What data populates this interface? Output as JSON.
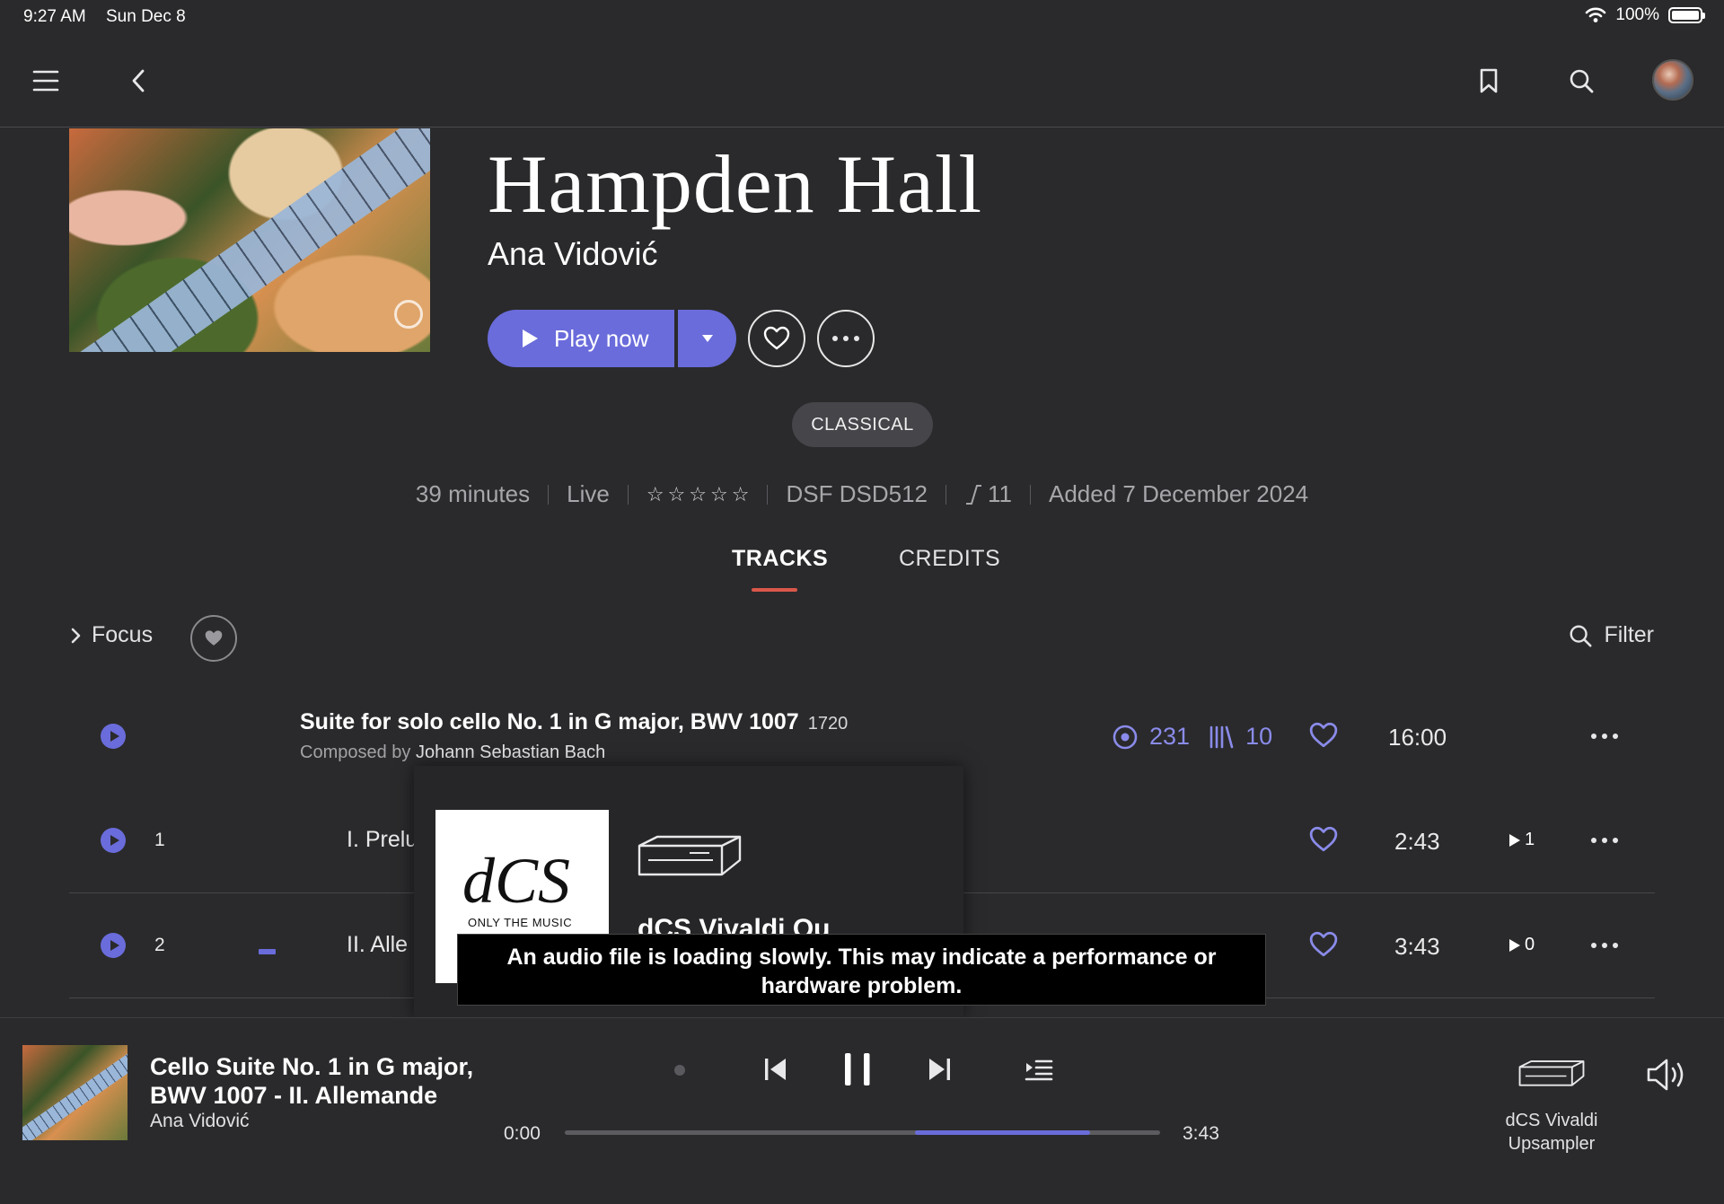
{
  "status_bar": {
    "time": "9:27 AM",
    "date": "Sun Dec 8",
    "battery": "100%",
    "icons": [
      "wifi-icon",
      "battery-icon"
    ]
  },
  "nav": {
    "icons": [
      "menu-icon",
      "back-icon",
      "bookmark-icon",
      "search-icon",
      "avatar"
    ]
  },
  "album": {
    "title": "Hampden Hall",
    "artist": "Ana Vidović",
    "play_label": "Play now",
    "genre": "CLASSICAL",
    "meta": {
      "duration": "39 minutes",
      "type": "Live",
      "rating": 0,
      "format": "DSF DSD512",
      "count": "11",
      "added": "Added 7 December 2024"
    }
  },
  "tabs": [
    {
      "label": "TRACKS",
      "active": true
    },
    {
      "label": "CREDITS",
      "active": false
    }
  ],
  "toolbar": {
    "focus_label": "Focus",
    "filter_label": "Filter"
  },
  "work": {
    "title": "Suite for solo cello No. 1 in G major, BWV 1007",
    "year": "1720",
    "composed_prefix": "Composed by",
    "composer": "Johann Sebastian Bach",
    "listeners": "231",
    "versions": "10",
    "duration": "16:00"
  },
  "tracks": [
    {
      "number": "1",
      "title": "I. Prelu",
      "duration": "2:43",
      "plays": "1"
    },
    {
      "number": "2",
      "title": "II. Alle",
      "duration": "3:43",
      "plays": "0"
    }
  ],
  "popup": {
    "logo_word": "dCS",
    "logo_tag": "ONLY THE MUSIC",
    "device_name": "dCS Vivaldi Ou",
    "toast": "An audio file is loading slowly. This may indicate a performance or hardware problem."
  },
  "player": {
    "title": "Cello Suite No. 1 in G major, BWV 1007 - II. Allemande",
    "artist": "Ana Vidović",
    "elapsed": "0:00",
    "total": "3:43",
    "progress": 0,
    "output_device": "dCS Vivaldi Upsampler"
  },
  "colors": {
    "background": "#2a2a2c",
    "accent": "#6a6cdb",
    "tab_underline": "#d9574a",
    "stats": "#8a8bea"
  }
}
